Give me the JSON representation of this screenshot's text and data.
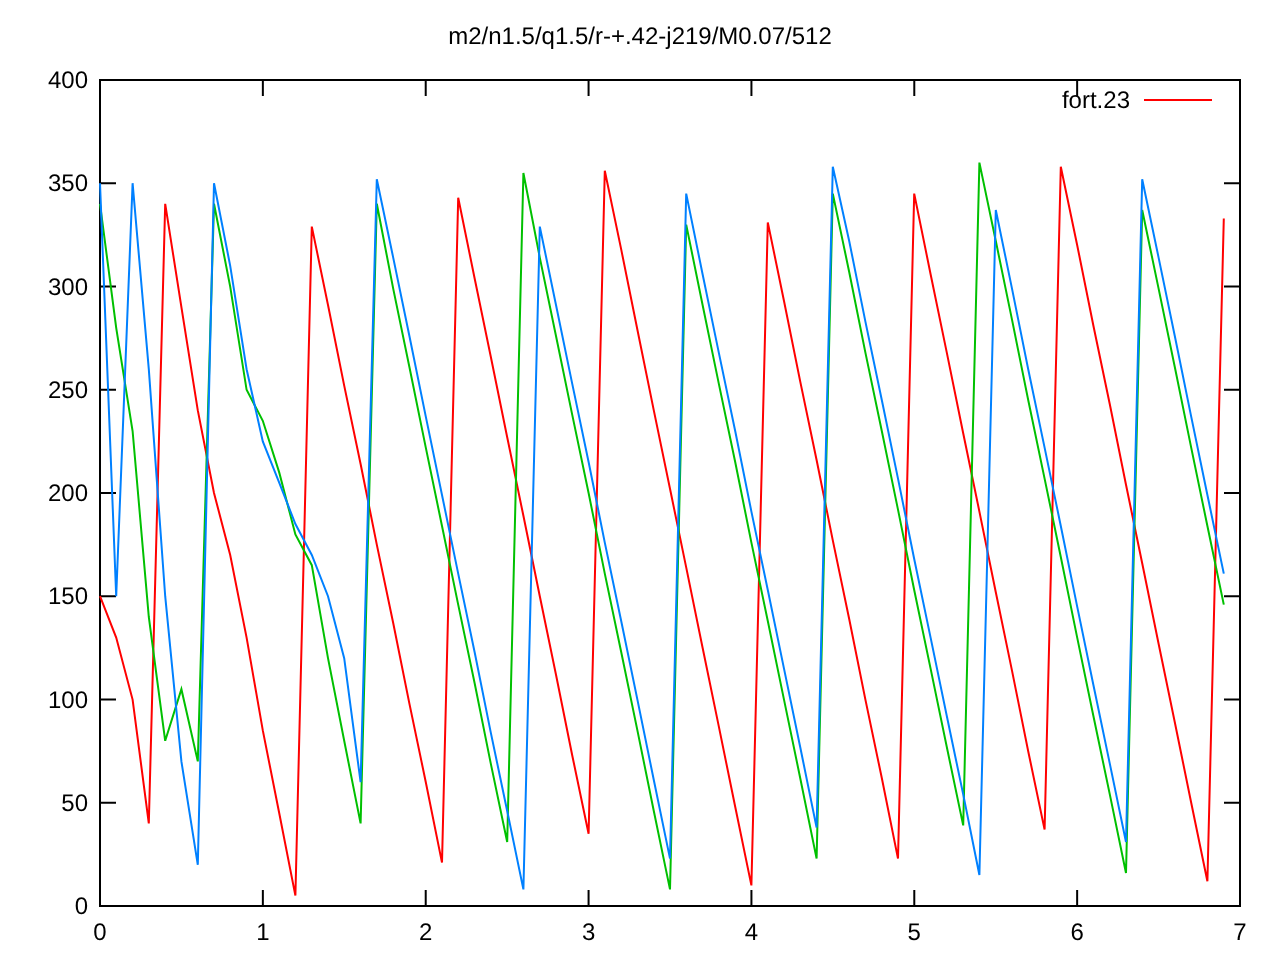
{
  "chart_data": {
    "type": "line",
    "title": "m2/n1.5/q1.5/r-+.42-j219/M0.07/512",
    "x": [
      0,
      0.1,
      0.2,
      0.3,
      0.4,
      0.5,
      0.6,
      0.7,
      0.8,
      0.9,
      1.0,
      1.1,
      1.2,
      1.3,
      1.4,
      1.5,
      1.6,
      1.7,
      1.8,
      1.9,
      2.0,
      2.1,
      2.2,
      2.3,
      2.4,
      2.5,
      2.6,
      2.7,
      2.8,
      2.9,
      3.0,
      3.1,
      3.2,
      3.3,
      3.4,
      3.5,
      3.6,
      3.7,
      3.8,
      3.9,
      4.0,
      4.1,
      4.2,
      4.3,
      4.4,
      4.5,
      4.6,
      4.7,
      4.8,
      4.9,
      5.0,
      5.1,
      5.2,
      5.3,
      5.4,
      5.5,
      5.6,
      5.7,
      5.8,
      5.9,
      6.0,
      6.1,
      6.2,
      6.3,
      6.4,
      6.5,
      6.6,
      6.7,
      6.8,
      6.9
    ],
    "series": [
      {
        "name": "fort.23",
        "color": "#ff0000",
        "values": [
          150,
          130,
          100,
          40,
          340,
          290,
          240,
          200,
          170,
          130,
          85,
          45,
          5,
          329,
          291,
          252,
          214,
          175,
          137,
          98,
          60,
          21,
          343,
          304,
          266,
          227,
          189,
          150,
          112,
          73,
          35,
          356,
          318,
          279,
          240,
          202,
          164,
          125,
          87,
          48,
          10,
          331,
          293,
          254,
          216,
          177,
          139,
          100,
          62,
          23,
          345,
          306,
          268,
          229,
          191,
          152,
          114,
          75,
          37,
          358,
          320,
          281,
          243,
          204,
          166,
          127,
          89,
          50,
          12,
          333
        ]
      },
      {
        "color": "#00c000",
        "values": [
          340,
          280,
          230,
          140,
          80,
          105,
          70,
          340,
          300,
          250,
          235,
          210,
          180,
          165,
          120,
          80,
          40,
          340,
          299,
          261,
          222,
          184,
          146,
          108,
          69,
          31,
          355,
          314,
          276,
          238,
          200,
          161,
          123,
          85,
          46,
          8,
          330,
          291,
          253,
          215,
          176,
          138,
          100,
          62,
          23,
          345,
          307,
          268,
          230,
          192,
          153,
          115,
          77,
          39,
          360,
          322,
          284,
          245,
          207,
          169,
          130,
          92,
          54,
          16,
          337,
          299,
          261,
          222,
          184,
          146
        ]
      },
      {
        "color": "#0080ff",
        "values": [
          350,
          150,
          350,
          260,
          150,
          70,
          20,
          350,
          310,
          260,
          225,
          205,
          185,
          170,
          150,
          120,
          60,
          352,
          314,
          276,
          237,
          199,
          161,
          123,
          84,
          46,
          8,
          329,
          291,
          253,
          215,
          176,
          138,
          100,
          61,
          23,
          345,
          306,
          268,
          230,
          191,
          153,
          115,
          77,
          38,
          358,
          322,
          283,
          245,
          207,
          168,
          130,
          92,
          54,
          15,
          337,
          299,
          260,
          222,
          184,
          145,
          107,
          69,
          31,
          352,
          314,
          276,
          237,
          199,
          161
        ]
      }
    ],
    "xlim": [
      0,
      7
    ],
    "ylim": [
      0,
      400
    ],
    "xticks": [
      0,
      1,
      2,
      3,
      4,
      5,
      6,
      7
    ],
    "yticks": [
      0,
      50,
      100,
      150,
      200,
      250,
      300,
      350,
      400
    ]
  }
}
